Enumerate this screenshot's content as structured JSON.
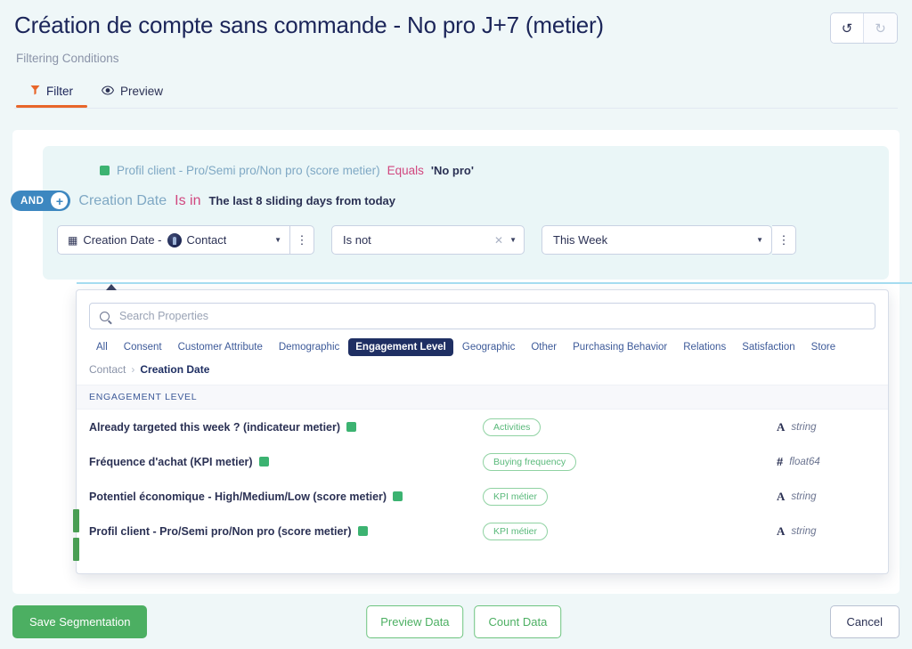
{
  "header": {
    "title": "Création de compte sans commande - No pro J+7 (metier)",
    "subtitle": "Filtering Conditions",
    "undo_icon": "undo-arrow",
    "redo_icon": "redo-arrow",
    "undo_glyph": "↺",
    "redo_glyph": "↻"
  },
  "tabs": [
    {
      "label": "Filter",
      "icon": "funnel-icon",
      "active": true
    },
    {
      "label": "Preview",
      "icon": "eye-icon",
      "active": false
    }
  ],
  "conditions": {
    "first": {
      "field": "Profil client - Pro/Semi pro/Non pro (score metier)",
      "operator": "Equals",
      "value": "'No pro'"
    },
    "connector": "AND",
    "add_glyph": "+",
    "second": {
      "field": "Creation Date",
      "operator": "Is in",
      "value": "The last 8 sliding days from today"
    },
    "selectors": {
      "property": "Creation Date -",
      "property_entity": "Contact",
      "property_icon": "calendar-icon",
      "property_glyph": "▦",
      "operator": "Is not",
      "value": "This Week",
      "clear_glyph": "✕",
      "caret_glyph": "▼",
      "kebab_glyph": "⋮"
    }
  },
  "properties_panel": {
    "search": {
      "placeholder": "Search Properties",
      "value": "",
      "icon": "search-icon"
    },
    "categories": [
      {
        "label": "All",
        "active": false
      },
      {
        "label": "Consent",
        "active": false
      },
      {
        "label": "Customer Attribute",
        "active": false
      },
      {
        "label": "Demographic",
        "active": false
      },
      {
        "label": "Engagement Level",
        "active": true
      },
      {
        "label": "Geographic",
        "active": false
      },
      {
        "label": "Other",
        "active": false
      },
      {
        "label": "Purchasing Behavior",
        "active": false
      },
      {
        "label": "Relations",
        "active": false
      },
      {
        "label": "Satisfaction",
        "active": false
      },
      {
        "label": "Store",
        "active": false
      }
    ],
    "breadcrumb": {
      "root": "Contact",
      "sep": "›",
      "current": "Creation Date"
    },
    "section_header": "ENGAGEMENT LEVEL",
    "rows": [
      {
        "name": "Already targeted this week ? (indicateur metier)",
        "tag": "Activities",
        "type": "string",
        "type_icon": "A"
      },
      {
        "name": "Fréquence d'achat (KPI metier)",
        "tag": "Buying frequency",
        "type": "float64",
        "type_icon": "#"
      },
      {
        "name": "Potentiel économique - High/Medium/Low (score metier)",
        "tag": "KPI métier",
        "type": "string",
        "type_icon": "A"
      },
      {
        "name": "Profil client - Pro/Semi pro/Non pro (score metier)",
        "tag": "KPI métier",
        "type": "string",
        "type_icon": "A"
      }
    ]
  },
  "footer": {
    "save": "Save Segmentation",
    "preview": "Preview Data",
    "count": "Count Data",
    "cancel": "Cancel"
  },
  "colors": {
    "accent_orange": "#e8662a",
    "green": "#4caf62",
    "navy": "#1f2f63",
    "pink": "#d1477f",
    "blue_pill": "#3d87c0",
    "page_bg": "#eff7f8"
  }
}
